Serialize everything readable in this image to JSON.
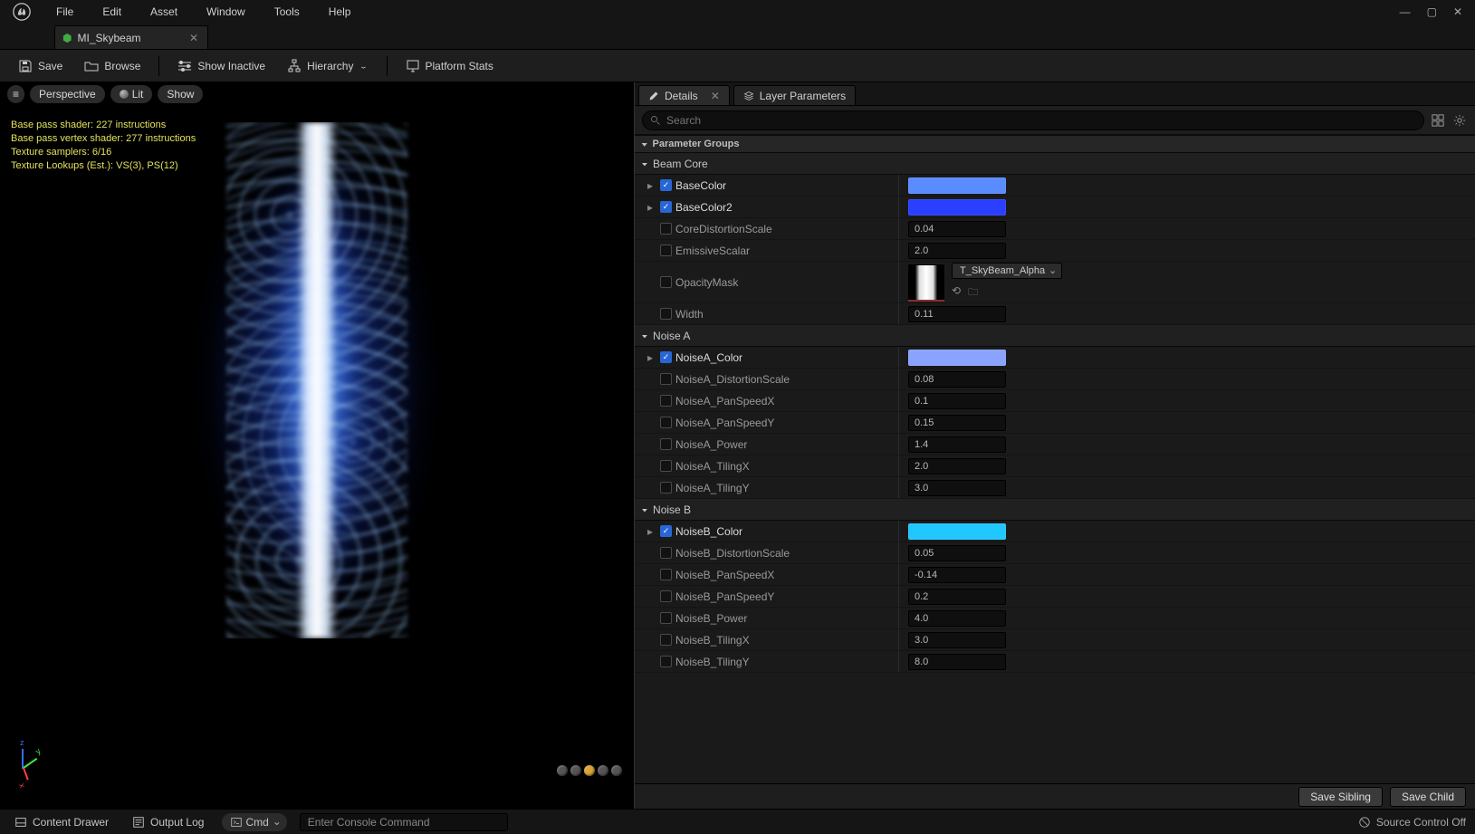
{
  "menubar": {
    "items": [
      "File",
      "Edit",
      "Asset",
      "Window",
      "Tools",
      "Help"
    ]
  },
  "doc_tab": {
    "title": "MI_Skybeam"
  },
  "toolbar": {
    "save": "Save",
    "browse": "Browse",
    "show_inactive": "Show Inactive",
    "hierarchy": "Hierarchy",
    "platform_stats": "Platform Stats"
  },
  "viewport": {
    "perspective": "Perspective",
    "lit": "Lit",
    "show": "Show",
    "stats": [
      "Base pass shader: 227 instructions",
      "Base pass vertex shader: 277 instructions",
      "Texture samplers: 6/16",
      "Texture Lookups (Est.): VS(3), PS(12)"
    ]
  },
  "panel": {
    "details": "Details",
    "layer_params": "Layer Parameters",
    "search_placeholder": "Search",
    "section": "Parameter Groups",
    "groups": {
      "beam_core": {
        "title": "Beam Core",
        "BaseColor_label": "BaseColor",
        "BaseColor_color": "#5a8cff",
        "BaseColor2_label": "BaseColor2",
        "BaseColor2_color": "#2a3fff",
        "CoreDistortionScale_label": "CoreDistortionScale",
        "CoreDistortionScale_val": "0.04",
        "EmissiveScalar_label": "EmissiveScalar",
        "EmissiveScalar_val": "2.0",
        "OpacityMask_label": "OpacityMask",
        "OpacityMask_asset": "T_SkyBeam_Alpha",
        "Width_label": "Width",
        "Width_val": "0.11"
      },
      "noise_a": {
        "title": "Noise A",
        "NoiseA_Color_label": "NoiseA_Color",
        "NoiseA_Color_color": "#8aa3ff",
        "NoiseA_DistortionScale_label": "NoiseA_DistortionScale",
        "NoiseA_DistortionScale_val": "0.08",
        "NoiseA_PanSpeedX_label": "NoiseA_PanSpeedX",
        "NoiseA_PanSpeedX_val": "0.1",
        "NoiseA_PanSpeedY_label": "NoiseA_PanSpeedY",
        "NoiseA_PanSpeedY_val": "0.15",
        "NoiseA_Power_label": "NoiseA_Power",
        "NoiseA_Power_val": "1.4",
        "NoiseA_TilingX_label": "NoiseA_TilingX",
        "NoiseA_TilingX_val": "2.0",
        "NoiseA_TilingY_label": "NoiseA_TilingY",
        "NoiseA_TilingY_val": "3.0"
      },
      "noise_b": {
        "title": "Noise B",
        "NoiseB_Color_label": "NoiseB_Color",
        "NoiseB_Color_color": "#20c8ff",
        "NoiseB_DistortionScale_label": "NoiseB_DistortionScale",
        "NoiseB_DistortionScale_val": "0.05",
        "NoiseB_PanSpeedX_label": "NoiseB_PanSpeedX",
        "NoiseB_PanSpeedX_val": "-0.14",
        "NoiseB_PanSpeedY_label": "NoiseB_PanSpeedY",
        "NoiseB_PanSpeedY_val": "0.2",
        "NoiseB_Power_label": "NoiseB_Power",
        "NoiseB_Power_val": "4.0",
        "NoiseB_TilingX_label": "NoiseB_TilingX",
        "NoiseB_TilingX_val": "3.0",
        "NoiseB_TilingY_label": "NoiseB_TilingY",
        "NoiseB_TilingY_val": "8.0"
      }
    },
    "save_sibling": "Save Sibling",
    "save_child": "Save Child"
  },
  "statusbar": {
    "content_drawer": "Content Drawer",
    "output_log": "Output Log",
    "cmd_label": "Cmd",
    "cmd_placeholder": "Enter Console Command",
    "source_control": "Source Control Off"
  }
}
